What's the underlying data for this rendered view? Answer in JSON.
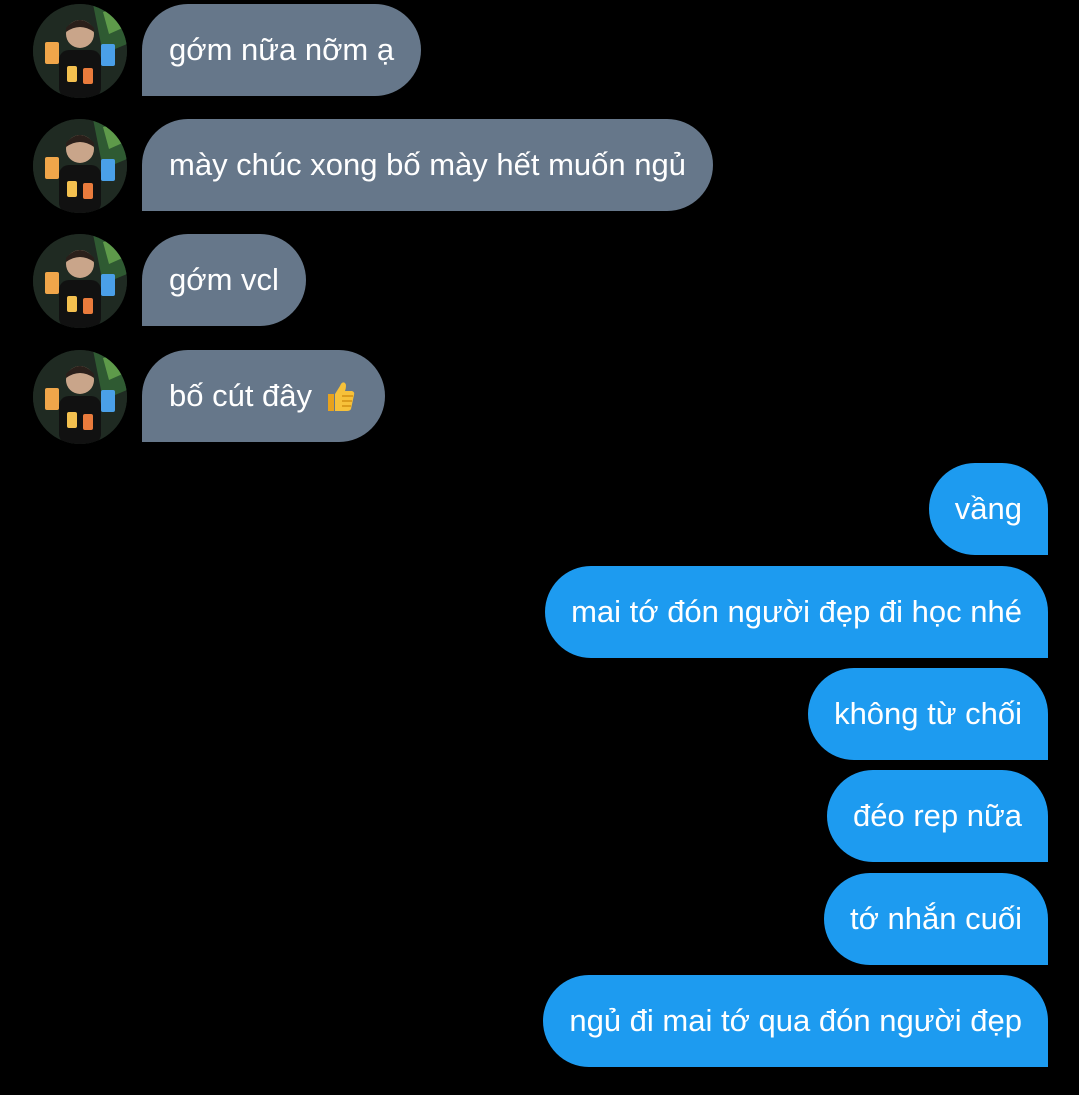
{
  "colors": {
    "background": "#000000",
    "incoming_bubble": "#66778a",
    "outgoing_bubble": "#1d9bf0",
    "text": "#ffffff"
  },
  "incoming_messages": [
    {
      "text": "gớm nữa nỡm ạ"
    },
    {
      "text": "mày chúc xong bố mày hết muốn ngủ"
    },
    {
      "text": "gớm vcl"
    },
    {
      "text": "bố cút đây",
      "emoji": "thumbs-up-icon"
    }
  ],
  "outgoing_messages": [
    {
      "text": "vầng"
    },
    {
      "text": "mai tớ đón người đẹp đi học nhé"
    },
    {
      "text": "không từ chối"
    },
    {
      "text": "đéo rep nữa"
    },
    {
      "text": "tớ nhắn cuối"
    },
    {
      "text": "ngủ đi mai tớ qua đón người đẹp"
    }
  ]
}
